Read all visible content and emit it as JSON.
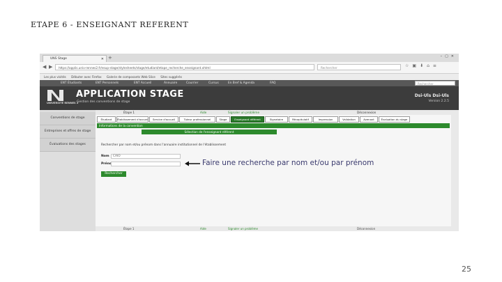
{
  "slide": {
    "title": "ETAPE 6 - ENSEIGNANT REFERENT",
    "page_number": "25"
  },
  "browser": {
    "tab_title": "UNS Stage",
    "new_tab": "+",
    "url": "https://applis.univ-rennes2.fr/esup-stage/stylesheets/stage/etudiant/etape_recherche_enseignant.xhtml",
    "search_placeholder": "Rechercher",
    "bookmarks": [
      "Les plus visités",
      "Débuter avec Firefox",
      "Galerie de composants Web Slice",
      "Sites suggérés"
    ]
  },
  "ent_nav": {
    "items": [
      "ENT Étudiants",
      "ENT Personnels",
      "ENT Accueil",
      "Annuaire",
      "Courrier",
      "Cursus",
      "En Bref & Agenda",
      "FAQ"
    ],
    "search_placeholder": "Rechercher"
  },
  "header": {
    "logo_text": "UNIVERSITÉ RENNES 2",
    "app_title": "APPLICATION STAGE",
    "app_subtitle": "Gestion des conventions de stage",
    "user_name": "Dsi-Uls Dsi-Uls",
    "user_version": "Version 2.2.5"
  },
  "steps_top": [
    "Étape 1",
    "Aide",
    "Signaler un problème",
    "Déconnexion"
  ],
  "sidebar": {
    "items": [
      "Conventions de stage",
      "Entreprises et offres de stage",
      "Évaluations des stages"
    ]
  },
  "wizard_tabs": [
    {
      "label": "Étudiant",
      "active": false
    },
    {
      "label": "Établissement d'accueil",
      "active": false
    },
    {
      "label": "Service d'accueil",
      "active": false
    },
    {
      "label": "Tuteur professionnel",
      "active": false
    },
    {
      "label": "Stage",
      "active": false
    },
    {
      "label": "Enseignant référent",
      "active": true
    },
    {
      "label": "Signataire",
      "active": false
    },
    {
      "label": "Récapitulatif",
      "active": false
    },
    {
      "label": "Impression",
      "active": false
    },
    {
      "label": "Validation",
      "active": false
    },
    {
      "label": "Avenant",
      "active": false
    },
    {
      "label": "Évaluation du stage",
      "active": false
    }
  ],
  "panel": {
    "section_title": "Informations de la convention",
    "subsection_title": "Sélection de l'enseignant référent",
    "hint": "Rechercher par nom et/ou prénom dans l'annuaire institutionnel de l'établissement",
    "nom_label": "Nom",
    "nom_value": "CAIO",
    "prenom_label": "Prénom",
    "prenom_value": "",
    "search_button": "Rechercher"
  },
  "steps_bottom": [
    "Étape 1",
    "Aide",
    "Signaler un problème",
    "Déconnexion"
  ],
  "annotation": {
    "text": "Faire une recherche par nom et/ou par prénom"
  },
  "colors": {
    "accent_green": "#2d8a2d",
    "header_dark": "#3c3c3c",
    "annotation_text": "#3a3a6e"
  }
}
